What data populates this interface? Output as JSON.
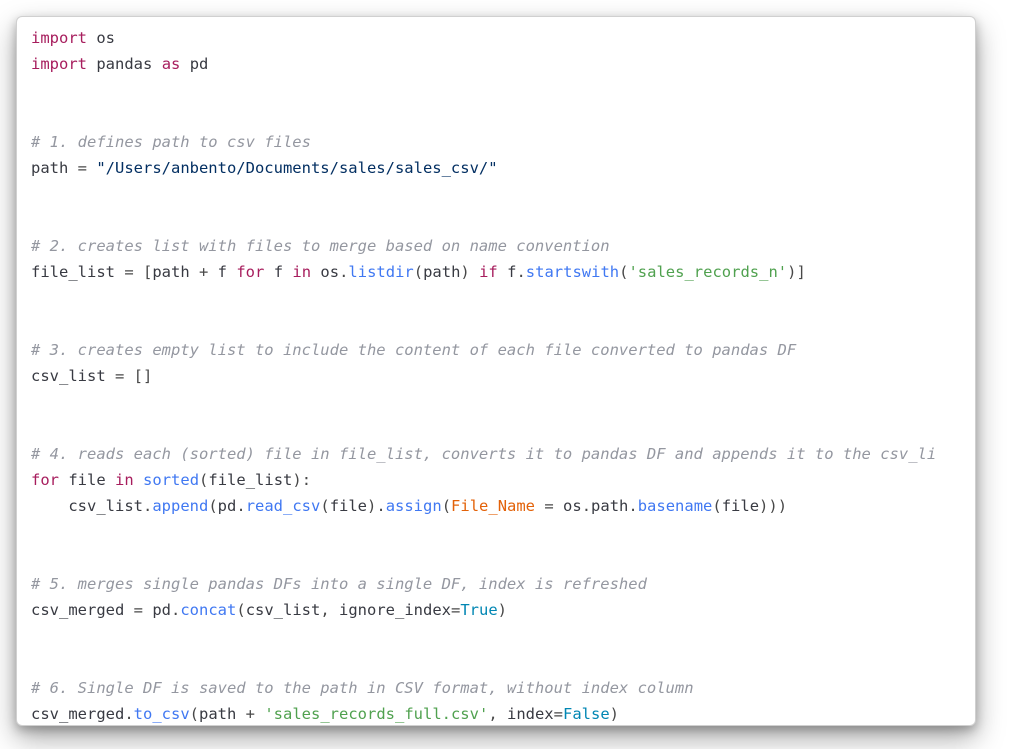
{
  "colors": {
    "keyword": "#a71d5d",
    "comment": "#9497a0",
    "string_dark": "#032f62",
    "string_green": "#50a14f",
    "call_blue": "#4078f2",
    "const_blue": "#0086b3",
    "param_orange": "#e36209",
    "text": "#383a42"
  },
  "tokens": {
    "l1_kw": "import",
    "l1_os": "os",
    "l2_kw": "import",
    "l2_pd": "pandas",
    "l2_as": "as",
    "l2_alias": "pd",
    "c1": "# 1. defines path to csv files",
    "l5_path": "path",
    "l5_eq": " = ",
    "l5_str": "\"/Users/anbento/Documents/sales/sales_csv/\"",
    "c2": "# 2. creates list with files to merge based on name convention",
    "l8_fl": "file_list",
    "l8_eq": " = [",
    "l8_path": "path",
    "l8_plus": " + ",
    "l8_f1": "f",
    "l8_for": "for",
    "l8_f2": "f",
    "l8_in": "in",
    "l8_os": "os",
    "l8_dot1": ".",
    "l8_listdir": "listdir",
    "l8_op": "(",
    "l8_path2": "path",
    "l8_cp": ")",
    "l8_if": "if",
    "l8_f3": "f",
    "l8_dot2": ".",
    "l8_sw": "startswith",
    "l8_op2": "(",
    "l8_lit": "'sales_records_n'",
    "l8_cp2": ")]",
    "c3": "# 3. creates empty list to include the content of each file converted to pandas DF",
    "l11_cl": "csv_list",
    "l11_eq": " = []",
    "c4": "# 4. reads each (sorted) file in file_list, converts it to pandas DF and appends it to the csv_li",
    "l14_for": "for",
    "l14_file": "file",
    "l14_in": "in",
    "l14_sorted": "sorted",
    "l14_op": "(",
    "l14_fl": "file_list",
    "l14_cp": "):",
    "l15_ind": "    ",
    "l15_cl": "csv_list",
    "l15_dot": ".",
    "l15_app": "append",
    "l15_op": "(",
    "l15_pd": "pd",
    "l15_dot2": ".",
    "l15_rc": "read_csv",
    "l15_op2": "(",
    "l15_file": "file",
    "l15_cp": ").",
    "l15_assign": "assign",
    "l15_op3": "(",
    "l15_fn": "File_Name",
    "l15_eq": " = ",
    "l15_os": "os",
    "l15_dot3": ".",
    "l15_path": "path",
    "l15_dot4": ".",
    "l15_bn": "basename",
    "l15_op4": "(",
    "l15_file2": "file",
    "l15_cp2": ")))",
    "c5": "# 5. merges single pandas DFs into a single DF, index is refreshed",
    "l18_cm": "csv_merged",
    "l18_eq": " = ",
    "l18_pd": "pd",
    "l18_dot": ".",
    "l18_concat": "concat",
    "l18_op": "(",
    "l18_cl": "csv_list",
    "l18_comma": ", ",
    "l18_ii": "ignore_index",
    "l18_eq2": "=",
    "l18_true": "True",
    "l18_cp": ")",
    "c6": "# 6. Single DF is saved to the path in CSV format, without index column",
    "l21_cm": "csv_merged",
    "l21_dot": ".",
    "l21_tc": "to_csv",
    "l21_op": "(",
    "l21_path": "path",
    "l21_plus": " + ",
    "l21_str": "'sales_records_full.csv'",
    "l21_comma": ", ",
    "l21_idx": "index",
    "l21_eq": "=",
    "l21_false": "False",
    "l21_cp": ")"
  }
}
